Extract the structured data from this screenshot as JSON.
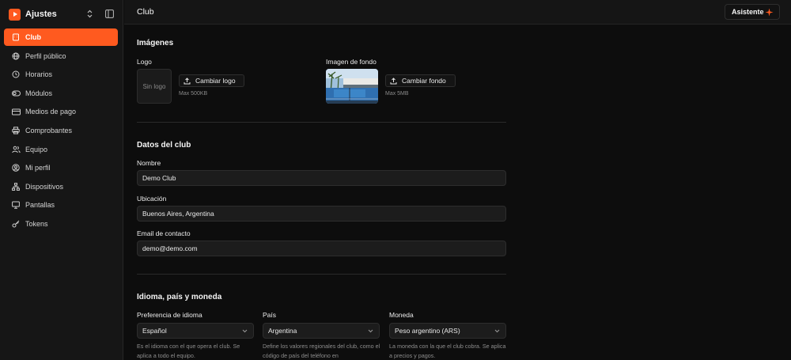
{
  "app": {
    "name": "Ajustes"
  },
  "sidebar": {
    "items": [
      {
        "label": "Club",
        "icon": "building-icon",
        "active": true
      },
      {
        "label": "Perfil público",
        "icon": "globe-icon"
      },
      {
        "label": "Horarios",
        "icon": "clock-icon"
      },
      {
        "label": "Módulos",
        "icon": "toggle-icon"
      },
      {
        "label": "Medios de pago",
        "icon": "credit-card-icon"
      },
      {
        "label": "Comprobantes",
        "icon": "printer-icon"
      },
      {
        "label": "Equipo",
        "icon": "users-icon"
      },
      {
        "label": "Mi perfil",
        "icon": "user-circle-icon"
      },
      {
        "label": "Dispositivos",
        "icon": "network-icon"
      },
      {
        "label": "Pantallas",
        "icon": "monitor-icon"
      },
      {
        "label": "Tokens",
        "icon": "key-icon"
      }
    ]
  },
  "header": {
    "title": "Club",
    "assistant_label": "Asistente"
  },
  "images": {
    "section_title": "Imágenes",
    "logo_label": "Logo",
    "logo_placeholder": "Sin logo",
    "logo_button": "Cambiar logo",
    "logo_hint": "Max 500KB",
    "background_label": "Imagen de fondo",
    "background_button": "Cambiar fondo",
    "background_hint": "Max 5MB"
  },
  "club_data": {
    "section_title": "Datos del club",
    "name_label": "Nombre",
    "name_value": "Demo Club",
    "location_label": "Ubicación",
    "location_value": "Buenos Aires, Argentina",
    "email_label": "Email de contacto",
    "email_value": "demo@demo.com"
  },
  "locale": {
    "section_title": "Idioma, país y moneda",
    "language_label": "Preferencia de idioma",
    "language_value": "Español",
    "language_desc": "Es el idioma con el que opera el club. Se aplica a todo el equipo.",
    "country_label": "País",
    "country_value": "Argentina",
    "country_desc": "Define los valores regionales del club, como el código de país del teléfono en",
    "currency_label": "Moneda",
    "currency_value": "Peso argentino (ARS)",
    "currency_desc": "La moneda con la que el club cobra. Se aplica a precios y pagos."
  },
  "colors": {
    "accent": "#ff5a1f",
    "background": "#0d0d0d",
    "sidebar": "#161616"
  }
}
